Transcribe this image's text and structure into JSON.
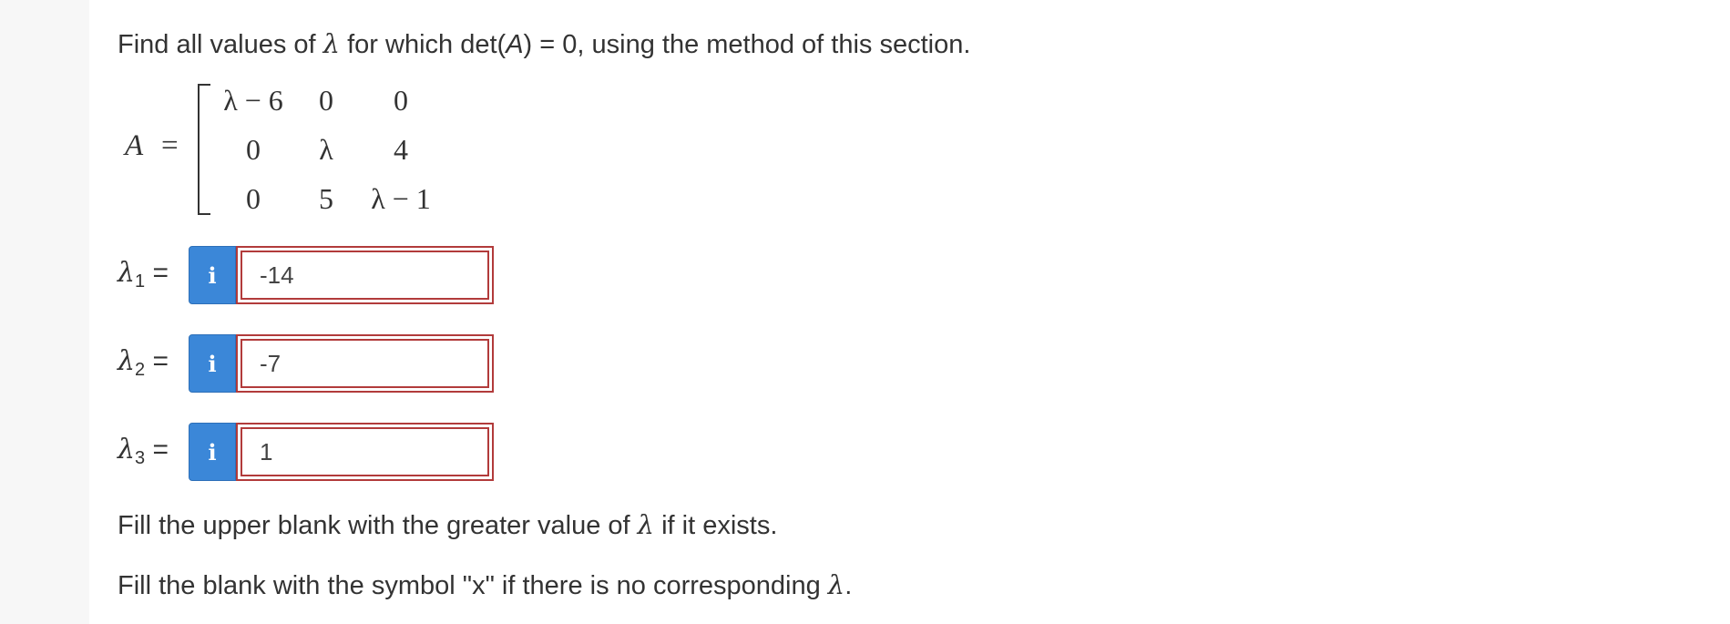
{
  "prompt": {
    "before_lambda": "Find all values of ",
    "lambda": "λ",
    "middle": " for which det(",
    "matrix_var": "A",
    "after": ") = 0, using the method of this section."
  },
  "matrix": {
    "name": "A",
    "equals": "=",
    "rows": [
      [
        "λ − 6",
        "0",
        "0"
      ],
      [
        "0",
        "λ",
        "4"
      ],
      [
        "0",
        "5",
        "λ − 1"
      ]
    ]
  },
  "answers": [
    {
      "symbol": "λ",
      "subscript": "1",
      "equals": " =",
      "info_icon": "i",
      "value": "-14"
    },
    {
      "symbol": "λ",
      "subscript": "2",
      "equals": " =",
      "info_icon": "i",
      "value": "-7"
    },
    {
      "symbol": "λ",
      "subscript": "3",
      "equals": " =",
      "info_icon": "i",
      "value": "1"
    }
  ],
  "instructions": {
    "line1_before": "Fill the upper blank with the greater value of ",
    "line1_lambda": "λ",
    "line1_after": " if it exists.",
    "line2_before": "Fill the blank with the symbol \"x\" if there is no corresponding ",
    "line2_lambda": "λ",
    "line2_after": "."
  },
  "colors": {
    "info_button": "#3b87d8",
    "input_border": "#b23b3b",
    "gutter": "#f7f7f7"
  }
}
